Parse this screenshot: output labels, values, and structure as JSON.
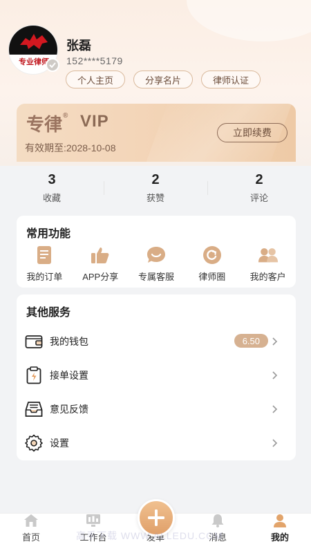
{
  "profile": {
    "avatar_text": "专业律师",
    "name": "张磊",
    "phone": "152****5179",
    "buttons": [
      "个人主页",
      "分享名片",
      "律师认证"
    ]
  },
  "vip": {
    "brand": "专律",
    "registered_mark": "®",
    "tag": "VIP",
    "expire": "有效期至:2028-10-08",
    "renew_label": "立即续费"
  },
  "stats": [
    {
      "value": "3",
      "label": "收藏"
    },
    {
      "value": "2",
      "label": "获赞"
    },
    {
      "value": "2",
      "label": "评论"
    }
  ],
  "functions": {
    "title": "常用功能",
    "items": [
      {
        "label": "我的订单",
        "icon": "order-icon"
      },
      {
        "label": "APP分享",
        "icon": "thumbs-up-icon"
      },
      {
        "label": "专属客服",
        "icon": "service-icon"
      },
      {
        "label": "律师圈",
        "icon": "circle-icon"
      },
      {
        "label": "我的客户",
        "icon": "customers-icon"
      }
    ]
  },
  "services": {
    "title": "其他服务",
    "items": [
      {
        "label": "我的钱包",
        "icon": "wallet-icon",
        "badge": "6.50"
      },
      {
        "label": "接单设置",
        "icon": "clipboard-icon"
      },
      {
        "label": "意见反馈",
        "icon": "inbox-icon"
      },
      {
        "label": "设置",
        "icon": "gear-icon"
      }
    ]
  },
  "tabbar": [
    {
      "label": "首页",
      "icon": "home-icon"
    },
    {
      "label": "工作台",
      "icon": "workbench-icon"
    },
    {
      "label": "发单",
      "icon": "plus-icon"
    },
    {
      "label": "消息",
      "icon": "bell-icon"
    },
    {
      "label": "我的",
      "icon": "user-icon",
      "active": true
    }
  ],
  "watermark": "高手下载 WWW.ALLEDU.COM",
  "colors": {
    "accent": "#d6b191",
    "icon": "#d9ad86",
    "vip_text": "#9a7460"
  }
}
